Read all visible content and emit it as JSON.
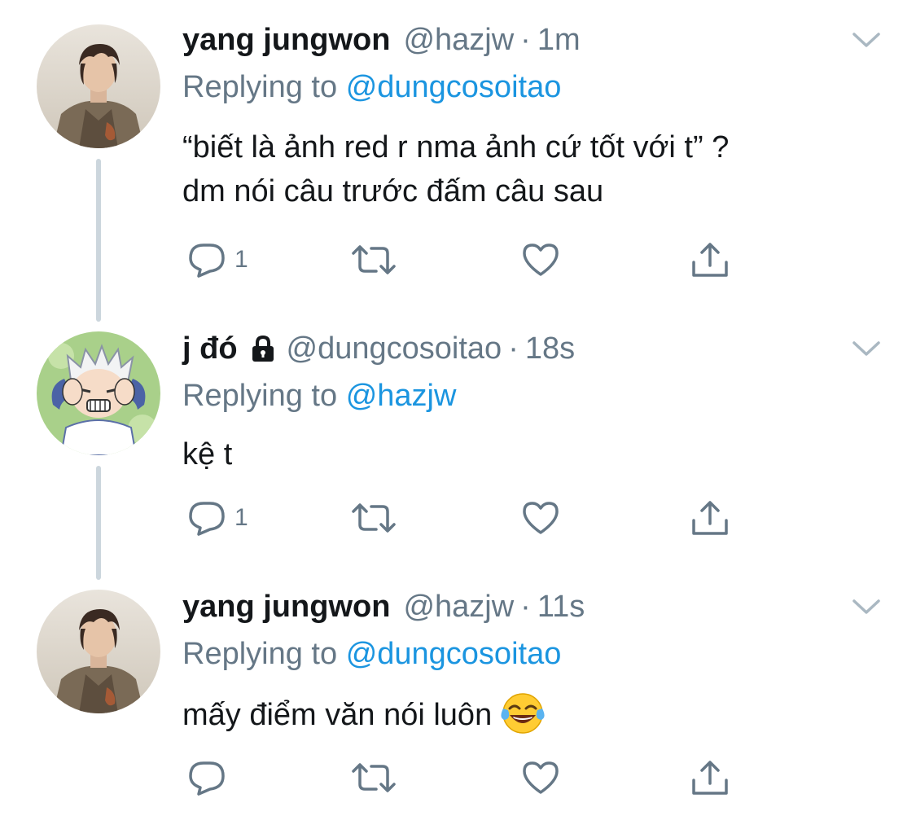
{
  "tweets": [
    {
      "display_name": "yang jungwon",
      "handle": "@hazjw",
      "separator": "·",
      "time": "1m",
      "replying_prefix": "Replying to",
      "replying_to": "@dungcosoitao",
      "body_lines": [
        "“biết là ảnh red r nma ảnh cứ tốt với t” ?",
        "dm nói câu trước đấm câu sau"
      ],
      "reply_count": "1",
      "protected": false,
      "avatar": "portrait-photo-avatar"
    },
    {
      "display_name": "j đó",
      "handle": "@dungcosoitao",
      "separator": "·",
      "time": "18s",
      "replying_prefix": "Replying to",
      "replying_to": "@hazjw",
      "body_lines": [
        "kệ t"
      ],
      "reply_count": "1",
      "protected": true,
      "avatar": "anime-character-avatar"
    },
    {
      "display_name": "yang jungwon",
      "handle": "@hazjw",
      "separator": "·",
      "time": "11s",
      "replying_prefix": "Replying to",
      "replying_to": "@dungcosoitao",
      "body_lines": [
        "mấy điểm văn nói luôn"
      ],
      "body_emoji": "tears-of-joy-emoji",
      "reply_count": "",
      "protected": false,
      "avatar": "portrait-photo-avatar"
    }
  ],
  "icons": {
    "reply": "reply-icon",
    "retweet": "retweet-icon",
    "like": "like-icon",
    "share": "share-icon",
    "caret": "chevron-down-icon",
    "lock": "lock-icon"
  },
  "colors": {
    "text": "#14171a",
    "secondary": "#657786",
    "link": "#1b95e0",
    "thread_line": "#ccd6dd"
  }
}
